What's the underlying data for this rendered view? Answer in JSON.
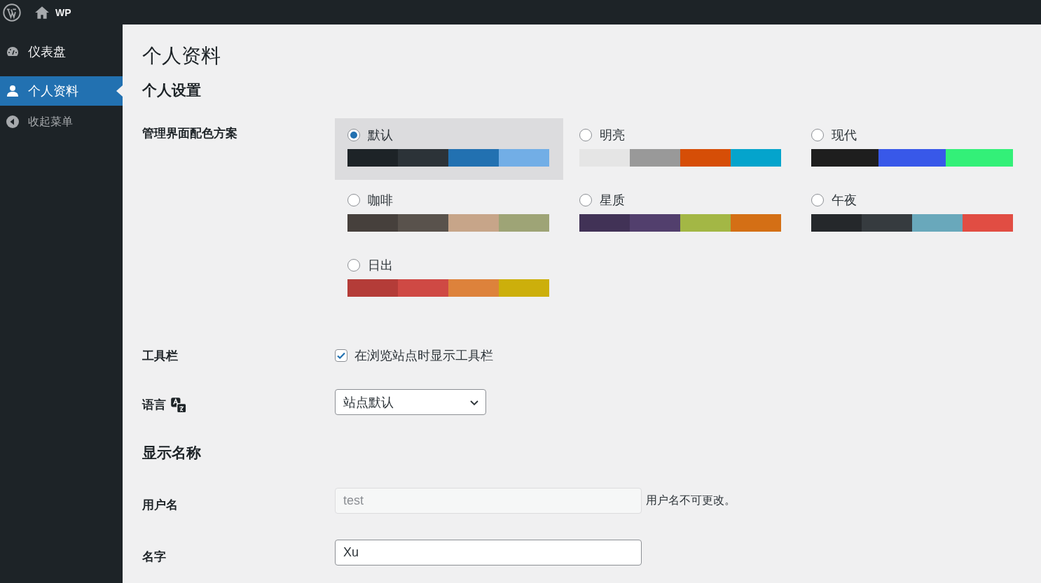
{
  "admin_bar": {
    "site_name": "WP"
  },
  "sidebar": {
    "items": [
      {
        "label": "仪表盘",
        "selected": false,
        "kind": "dashboard"
      },
      {
        "label": "个人资料",
        "selected": true,
        "kind": "profile"
      },
      {
        "label": "收起菜单",
        "selected": false,
        "kind": "collapse"
      }
    ]
  },
  "page_title": "个人资料",
  "section_personal": {
    "heading": "个人设置",
    "color_scheme": {
      "label": "管理界面配色方案",
      "schemes": [
        {
          "name": "默认",
          "selected": true,
          "swatches": [
            {
              "color": "#1d2327"
            },
            {
              "color": "#2c3338"
            },
            {
              "color": "#2271b1"
            },
            {
              "color": "#72aee6"
            }
          ]
        },
        {
          "name": "明亮",
          "selected": false,
          "swatches": [
            {
              "color": "#e5e5e5"
            },
            {
              "color": "#999999"
            },
            {
              "color": "#d64e07"
            },
            {
              "color": "#04a4cc"
            }
          ]
        },
        {
          "name": "现代",
          "selected": false,
          "swatches": [
            {
              "color": "#1e1e1e"
            },
            {
              "color": "#3858e9"
            },
            {
              "color": "#33f078"
            }
          ]
        },
        {
          "name": "咖啡",
          "selected": false,
          "swatches": [
            {
              "color": "#46403c"
            },
            {
              "color": "#59524c"
            },
            {
              "color": "#c7a589"
            },
            {
              "color": "#9ea476"
            }
          ]
        },
        {
          "name": "星质",
          "selected": false,
          "swatches": [
            {
              "color": "#413256"
            },
            {
              "color": "#523f6d"
            },
            {
              "color": "#a3b745"
            },
            {
              "color": "#d46f15"
            }
          ]
        },
        {
          "name": "午夜",
          "selected": false,
          "swatches": [
            {
              "color": "#25282b"
            },
            {
              "color": "#363b3f"
            },
            {
              "color": "#69a8bb"
            },
            {
              "color": "#e14d43"
            }
          ]
        },
        {
          "name": "日出",
          "selected": false,
          "swatches": [
            {
              "color": "#b43c38"
            },
            {
              "color": "#cf4944"
            },
            {
              "color": "#dd823b"
            },
            {
              "color": "#ccaf0b"
            }
          ]
        }
      ]
    },
    "toolbar": {
      "label": "工具栏",
      "option": "在浏览站点时显示工具栏",
      "checked": true
    },
    "language": {
      "label": "语言",
      "value": "站点默认"
    }
  },
  "section_name": {
    "heading": "显示名称",
    "username": {
      "label": "用户名",
      "value": "test",
      "disabled": true,
      "description": "用户名不可更改。"
    },
    "first_name": {
      "label": "名字",
      "value": "Xu",
      "disabled": false
    }
  }
}
